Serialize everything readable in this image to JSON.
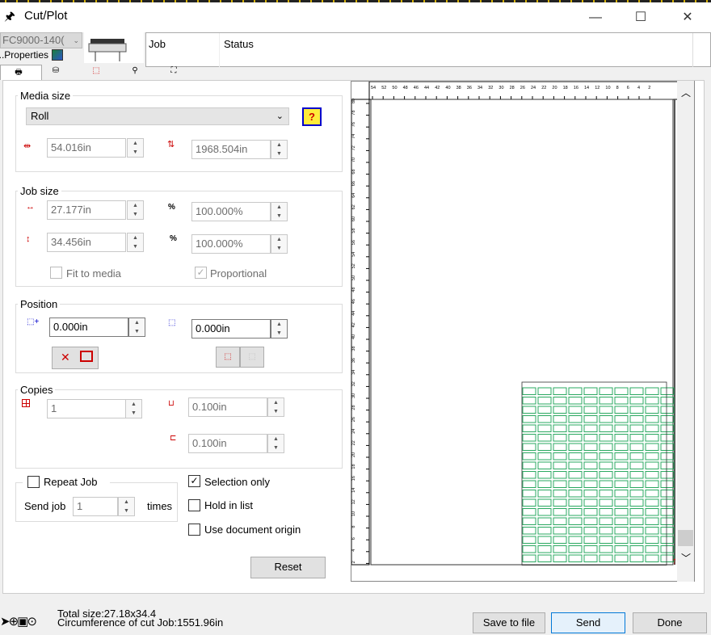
{
  "window": {
    "title": "Cut/Plot",
    "minimize": "—",
    "maximize": "☐",
    "close": "✕"
  },
  "device": {
    "selector": "FC9000-140(",
    "properties": "Properties..."
  },
  "queue": {
    "col_job": "Job",
    "col_status": "Status"
  },
  "tabs": [
    "🖶",
    "⛁",
    "⬚",
    "⚲",
    "⛶"
  ],
  "media": {
    "label": "Media size",
    "select": "Roll",
    "width": "54.016in",
    "length": "1968.504in"
  },
  "job_size": {
    "label": "Job size",
    "width": "27.177in",
    "height": "34.456in",
    "width_pct": "100.000%",
    "height_pct": "100.000%",
    "fit": "Fit to media",
    "proportional": "Proportional",
    "proportional_check": "✓"
  },
  "position": {
    "label": "Position",
    "x": "0.000in",
    "y": "0.000in"
  },
  "copies": {
    "label": "Copies",
    "count": "1",
    "spacing_x": "0.100in",
    "spacing_y": "0.100in"
  },
  "repeat": {
    "label": "Repeat Job",
    "send_job": "Send job",
    "send_value": "1",
    "times": "times"
  },
  "options": {
    "selection_only": "Selection only",
    "selection_check": "✓",
    "hold": "Hold in list",
    "use_origin": "Use document origin"
  },
  "reset": "Reset",
  "ruler": {
    "top": [
      "54",
      "52",
      "50",
      "48",
      "46",
      "44",
      "42",
      "40",
      "38",
      "36",
      "34",
      "32",
      "30",
      "28",
      "26",
      "24",
      "22",
      "20",
      "18",
      "16",
      "14",
      "12",
      "10",
      "8",
      "6",
      "4",
      "2"
    ],
    "left": [
      "80",
      "78",
      "76",
      "74",
      "72",
      "70",
      "68",
      "66",
      "64",
      "62",
      "60",
      "58",
      "56",
      "54",
      "52",
      "50",
      "48",
      "46",
      "44",
      "42",
      "40",
      "38",
      "36",
      "34",
      "32",
      "30",
      "28",
      "26",
      "24",
      "22",
      "20",
      "18",
      "16",
      "14",
      "12",
      "10",
      "8",
      "6",
      "4",
      "2"
    ]
  },
  "status": {
    "total": "Total size:27.18x34.4",
    "circumference": "Circumference of cut Job:1551.96in"
  },
  "buttons": {
    "save": "Save to file",
    "send": "Send",
    "done": "Done"
  },
  "colors": {
    "grid": "#2aa860",
    "accent": "#0078d7"
  }
}
